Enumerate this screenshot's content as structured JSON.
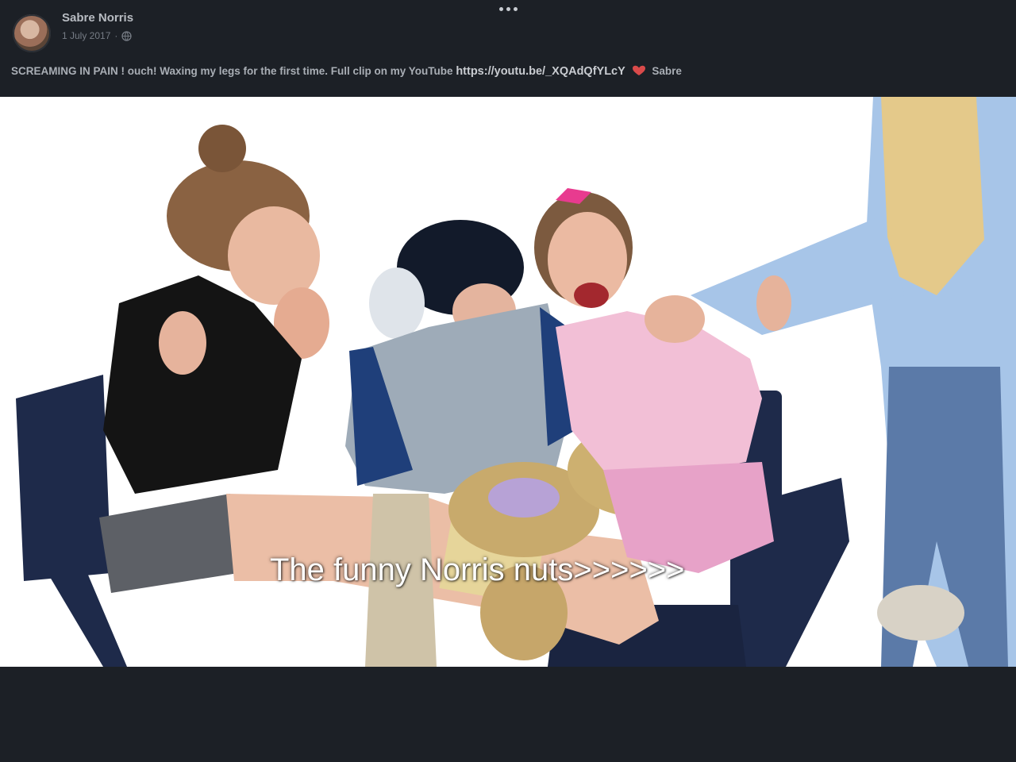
{
  "post": {
    "author": "Sabre Norris",
    "date": "1 July 2017",
    "separator": "·",
    "privacy_icon": "globe-icon",
    "more_icon": "more-options-icon",
    "caption": {
      "text_before": "SCREAMING IN PAIN ! ouch! Waxing my legs for the first time. Full clip on my YouTube",
      "link": "https://youtu.be/_XQAdQfYLcY",
      "emoji": "heart-icon",
      "text_after": "Sabre"
    }
  },
  "video": {
    "subtitle": "The funny Norris nuts>>>>>>"
  },
  "colors": {
    "background": "#1c2026",
    "author_text": "#b8bcc2",
    "meta_text": "#767c85",
    "heart": "#d94a4a"
  }
}
